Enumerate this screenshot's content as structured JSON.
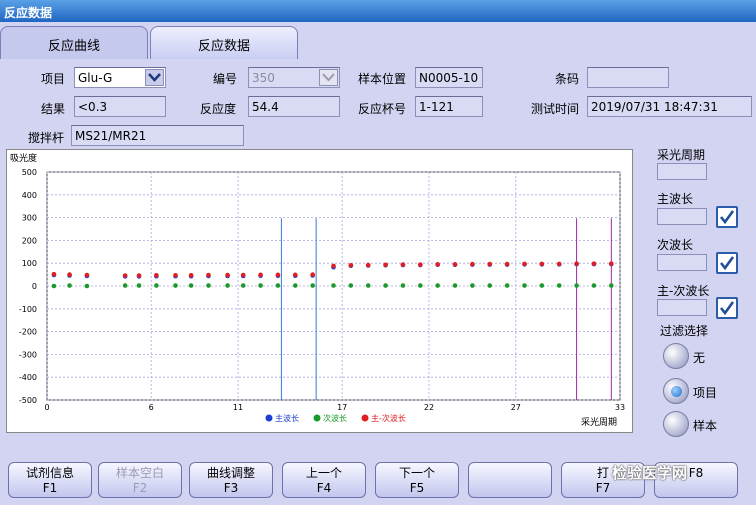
{
  "window": {
    "title": "反应数据"
  },
  "tabs": [
    {
      "label": "反应曲线",
      "active": true
    },
    {
      "label": "反应数据",
      "active": false
    }
  ],
  "form": {
    "project_label": "项目",
    "project_value": "Glu-G",
    "number_label": "编号",
    "number_value": "350",
    "sample_pos_label": "样本位置",
    "sample_pos_value": "N0005-10",
    "barcode_label": "条码",
    "barcode_value": "",
    "result_label": "结果",
    "result_value": "<0.3",
    "reaction_label": "反应度",
    "reaction_value": "54.4",
    "cup_label": "反应杯号",
    "cup_value": "1-121",
    "testtime_label": "测试时间",
    "testtime_value": "2019/07/31 18:47:31",
    "stirrer_label": "搅拌杆",
    "stirrer_value": "MS21/MR21"
  },
  "right_panel": {
    "period_label": "采光周期",
    "period_value": "",
    "main_wave_label": "主波长",
    "main_wave_value": "",
    "main_wave_checked": true,
    "sub_wave_label": "次波长",
    "sub_wave_value": "",
    "sub_wave_checked": true,
    "diff_wave_label": "主-次波长",
    "diff_wave_value": "",
    "diff_wave_checked": true,
    "filter_label": "过滤选择",
    "filter_options": [
      {
        "label": "无",
        "selected": false
      },
      {
        "label": "项目",
        "selected": true
      },
      {
        "label": "样本",
        "selected": false
      }
    ]
  },
  "function_buttons": [
    {
      "label": "试剂信息",
      "key": "F1",
      "enabled": true
    },
    {
      "label": "样本空白",
      "key": "F2",
      "enabled": false
    },
    {
      "label": "曲线调整",
      "key": "F3",
      "enabled": true
    },
    {
      "label": "上一个",
      "key": "F4",
      "enabled": true
    },
    {
      "label": "下一个",
      "key": "F5",
      "enabled": true
    },
    {
      "label": "",
      "key": "",
      "enabled": true
    },
    {
      "label": "打",
      "key": "F7",
      "enabled": true
    },
    {
      "label": "",
      "key": "F8",
      "enabled": true
    }
  ],
  "watermark": "检验医学网",
  "colors": {
    "main": "#1f3fd0",
    "sub": "#1a9a2a",
    "diff": "#e02020",
    "grid": "#a6a6e0",
    "vline_blue": "#3a7ad8",
    "vline_purple": "#9a2aa8"
  },
  "chart_data": {
    "type": "scatter",
    "ylabel": "吸光度",
    "xlabel": "采光周期",
    "xlim": [
      0,
      33
    ],
    "ylim": [
      -500,
      500
    ],
    "xticks": [
      0,
      6,
      11,
      17,
      22,
      27,
      33
    ],
    "yticks": [
      500,
      400,
      300,
      200,
      100,
      0,
      -100,
      -200,
      -300,
      -400,
      -500
    ],
    "vlines": [
      {
        "x": 13.5,
        "color": "blue"
      },
      {
        "x": 15.5,
        "color": "blue"
      },
      {
        "x": 30.5,
        "color": "purple"
      },
      {
        "x": 32.5,
        "color": "purple"
      }
    ],
    "legend": [
      "主波长",
      "次波长",
      "主-次波长"
    ],
    "series": [
      {
        "name": "次波长",
        "x": [
          0.4,
          1.3,
          2.3,
          4.5,
          5.3,
          6.3,
          7.4,
          8.3,
          9.3,
          10.4,
          11.3,
          12.3,
          13.3,
          14.3,
          15.3,
          16.5,
          17.5,
          18.5,
          19.5,
          20.5,
          21.5,
          22.5,
          23.5,
          24.5,
          25.5,
          26.5,
          27.5,
          28.5,
          29.5,
          30.5,
          31.5,
          32.5
        ],
        "y": [
          0,
          2,
          0,
          2,
          2,
          2,
          2,
          2,
          2,
          2,
          2,
          2,
          2,
          2,
          2,
          2,
          2,
          2,
          2,
          2,
          2,
          2,
          2,
          2,
          2,
          2,
          2,
          2,
          2,
          2,
          2,
          2
        ]
      },
      {
        "name": "主波长",
        "x": [
          0.4,
          1.3,
          2.3,
          4.5,
          5.3,
          6.3,
          7.4,
          8.3,
          9.3,
          10.4,
          11.3,
          12.3,
          13.3,
          14.3,
          15.3,
          16.5,
          17.5,
          18.5,
          19.5,
          20.5,
          21.5,
          22.5,
          23.5,
          24.5,
          25.5,
          26.5,
          27.5,
          28.5,
          29.5,
          30.5,
          31.5,
          32.5
        ],
        "y": [
          48,
          46,
          44,
          42,
          42,
          43,
          43,
          43,
          44,
          44,
          44,
          45,
          45,
          45,
          46,
          82,
          89,
          90,
          91,
          92,
          92,
          93,
          93,
          94,
          94,
          94,
          95,
          95,
          95,
          96,
          96,
          96
        ]
      },
      {
        "name": "主-次波长",
        "x": [
          0.4,
          1.3,
          2.3,
          4.5,
          5.3,
          6.3,
          7.4,
          8.3,
          9.3,
          10.4,
          11.3,
          12.3,
          13.3,
          14.3,
          15.3,
          16.5,
          17.5,
          18.5,
          19.5,
          20.5,
          21.5,
          22.5,
          23.5,
          24.5,
          25.5,
          26.5,
          27.5,
          28.5,
          29.5,
          30.5,
          31.5,
          32.5
        ],
        "y": [
          52,
          50,
          48,
          46,
          46,
          47,
          47,
          47,
          48,
          48,
          48,
          49,
          49,
          49,
          50,
          88,
          91,
          92,
          93,
          94,
          94,
          95,
          95,
          96,
          96,
          96,
          97,
          97,
          97,
          98,
          98,
          98
        ]
      }
    ]
  }
}
